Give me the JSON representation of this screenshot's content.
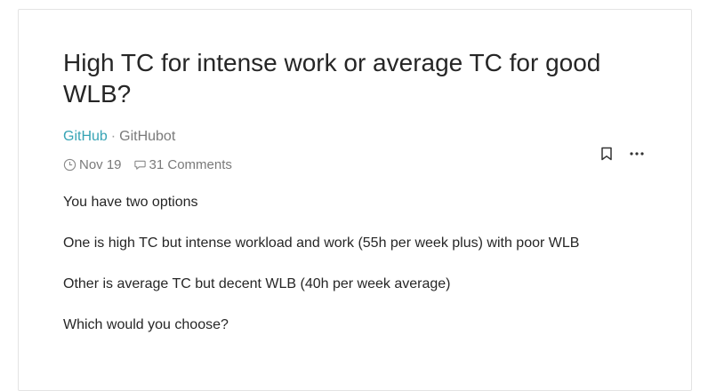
{
  "post": {
    "title": "High TC for intense work or average TC for good WLB?",
    "company": "GitHub",
    "separator": "·",
    "author": "GitHubot",
    "date": "Nov 19",
    "comments": "31 Comments",
    "paragraphs": [
      "You have two options",
      "One is high TC but intense workload and work (55h per week plus) with poor WLB",
      "Other is average TC but decent WLB (40h per week average)",
      "Which would you choose?"
    ]
  },
  "icons": {
    "date": "clock-icon",
    "comments": "comment-bubble-icon",
    "bookmark": "bookmark-icon",
    "more": "more-horizontal-icon"
  },
  "colors": {
    "company_link": "#37a4b5",
    "text": "#262626",
    "muted": "#7a7a7a"
  }
}
